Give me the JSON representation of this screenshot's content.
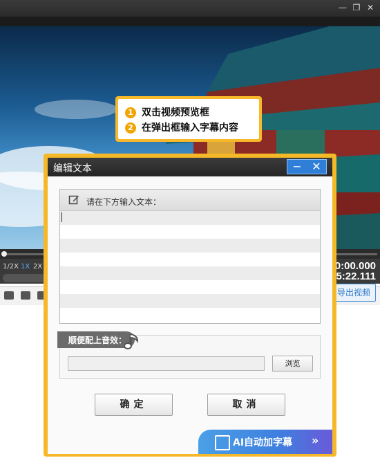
{
  "app": {
    "speed_options": [
      "1/2X",
      "1X",
      "2X"
    ],
    "current_time": "0:00.000",
    "total_time": "5:22.111",
    "export_label": "导出视频"
  },
  "callout": {
    "steps": [
      {
        "num": "1",
        "text": "双击视频预览框"
      },
      {
        "num": "2",
        "text": "在弹出框输入字幕内容"
      }
    ]
  },
  "dialog": {
    "title": "编辑文本",
    "prompt_label": "请在下方输入文本：",
    "text_value": "",
    "audio_label": "顺便配上音效：",
    "audio_file_value": "",
    "browse_label": "浏览",
    "ok_label": "确定",
    "cancel_label": "取消",
    "ai_banner_label": "AI自动加字幕"
  },
  "colors": {
    "accent_orange": "#f5b829",
    "accent_blue": "#2f7ed8"
  }
}
